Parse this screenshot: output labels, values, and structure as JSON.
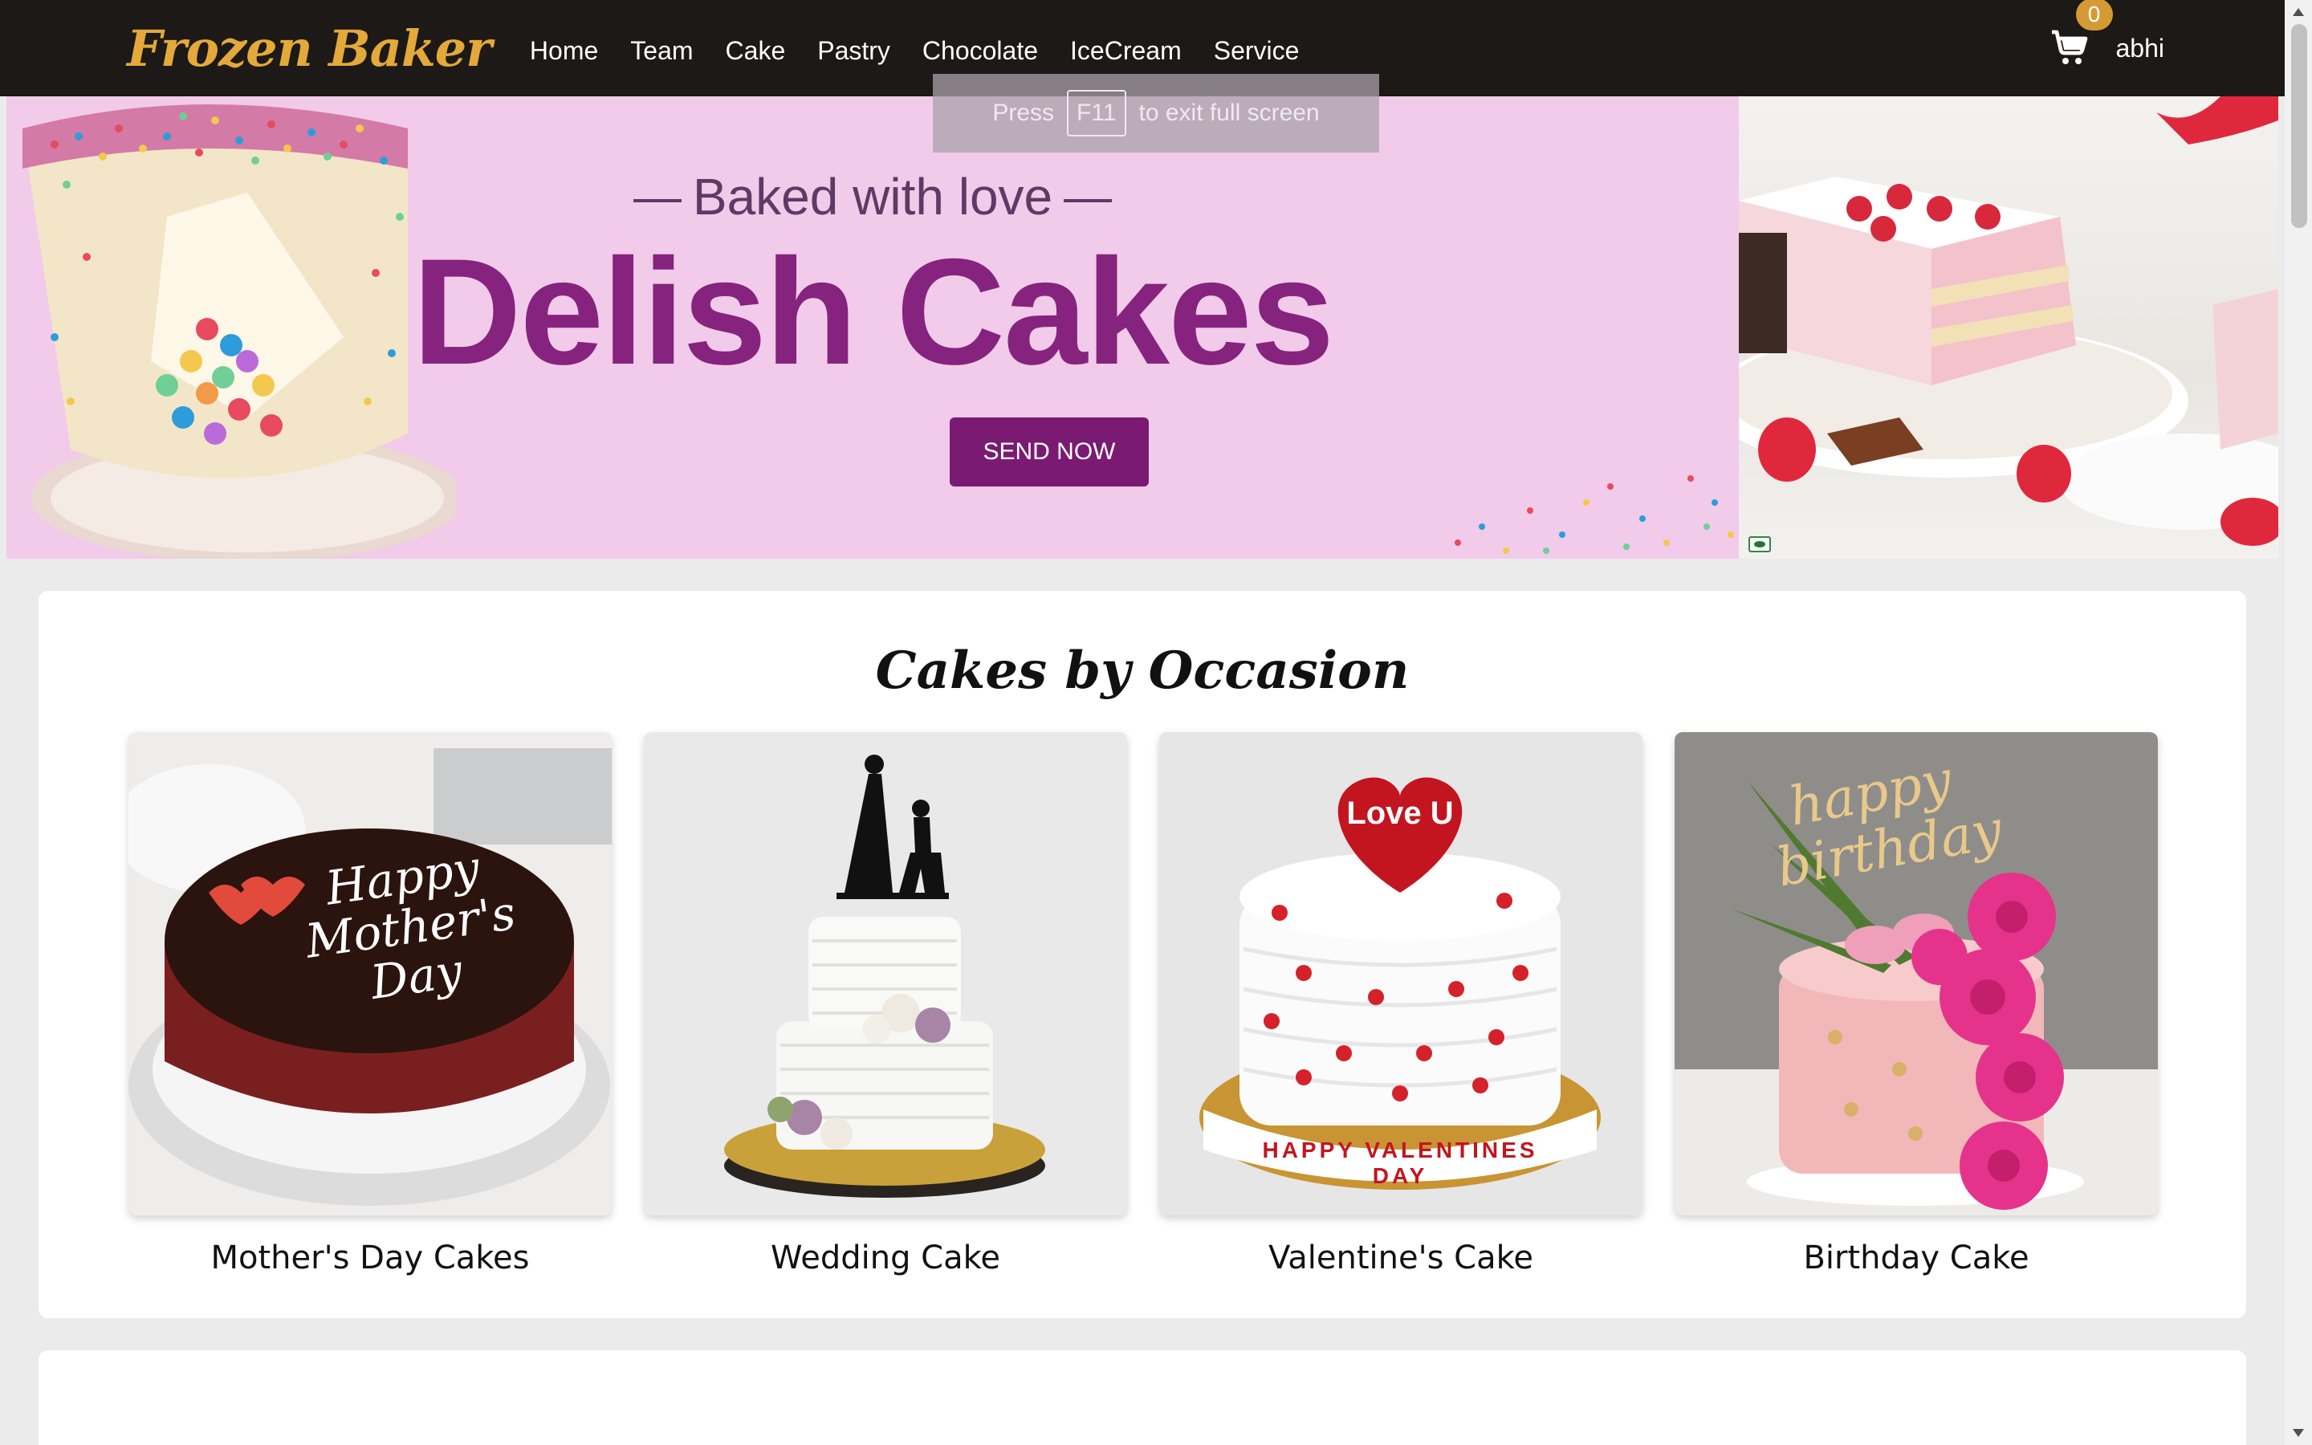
{
  "navbar": {
    "brand": "Frozen Baker",
    "links": [
      "Home",
      "Team",
      "Cake",
      "Pastry",
      "Chocolate",
      "IceCream",
      "Service"
    ],
    "cart_count": "0",
    "user_name": "abhi",
    "icons": {
      "cart": "shopping-cart-icon"
    }
  },
  "fullscreen_toast": {
    "prefix": "Press",
    "key": "F11",
    "suffix": "to exit full screen"
  },
  "hero": {
    "tagline": "Baked with love",
    "title": "Delish Cakes",
    "button_label": "SEND NOW"
  },
  "occasions": {
    "title": "Cakes by Occasion",
    "items": [
      {
        "label": "Mother's Day Cakes",
        "cake_text": "Happy Mother's Day"
      },
      {
        "label": "Wedding Cake"
      },
      {
        "label": "Valentine's Cake",
        "topper_text": "Love U",
        "ribbon_text": "HAPPY VALENTINES DAY"
      },
      {
        "label": "Birthday Cake",
        "topper_text": "happy birthday"
      }
    ]
  },
  "colors": {
    "navbar_bg": "#1c1917",
    "brand": "#e3a93a",
    "hero_bg": "#f1cbe9",
    "hero_title": "#86237e",
    "hero_button": "#7a1a72",
    "badge": "#d49a34"
  }
}
